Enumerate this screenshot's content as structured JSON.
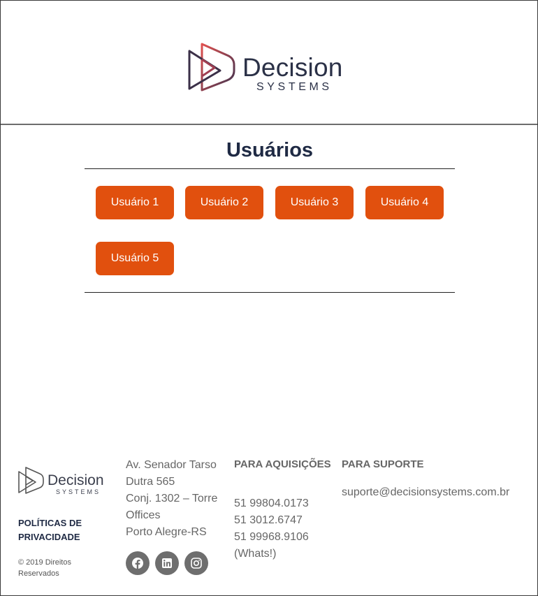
{
  "header": {
    "logo_word": "Decision",
    "logo_sub": "SYSTEMS"
  },
  "main": {
    "title": "Usuários",
    "users": [
      {
        "label": "Usuário 1"
      },
      {
        "label": "Usuário 2"
      },
      {
        "label": "Usuário 3"
      },
      {
        "label": "Usuário 4"
      },
      {
        "label": "Usuário 5"
      }
    ]
  },
  "footer": {
    "logo_word": "Decision",
    "logo_sub": "SYSTEMS",
    "policy_label": "POLÍTICAS DE PRIVACIDADE",
    "copyright": "© 2019 Direitos Reservados",
    "address": [
      "Av. Senador Tarso Dutra 565",
      "Conj. 1302 – Torre Offices",
      "Porto Alegre-RS"
    ],
    "social_icons": [
      "facebook-icon",
      "linkedin-icon",
      "instagram-icon"
    ],
    "acquisitions_heading": "PARA AQUISIÇÕES",
    "acquisitions_phones": [
      "51 99804.0173",
      "51 3012.6747",
      "51 99968.9106 (Whats!)"
    ],
    "support_heading": "PARA SUPORTE",
    "support_email": "suporte@decisionsystems.com.br"
  },
  "colors": {
    "accent": "#e1500e",
    "text_dark": "#1f2a44",
    "text_muted": "#666666",
    "social_bg": "#6e6e6e"
  }
}
